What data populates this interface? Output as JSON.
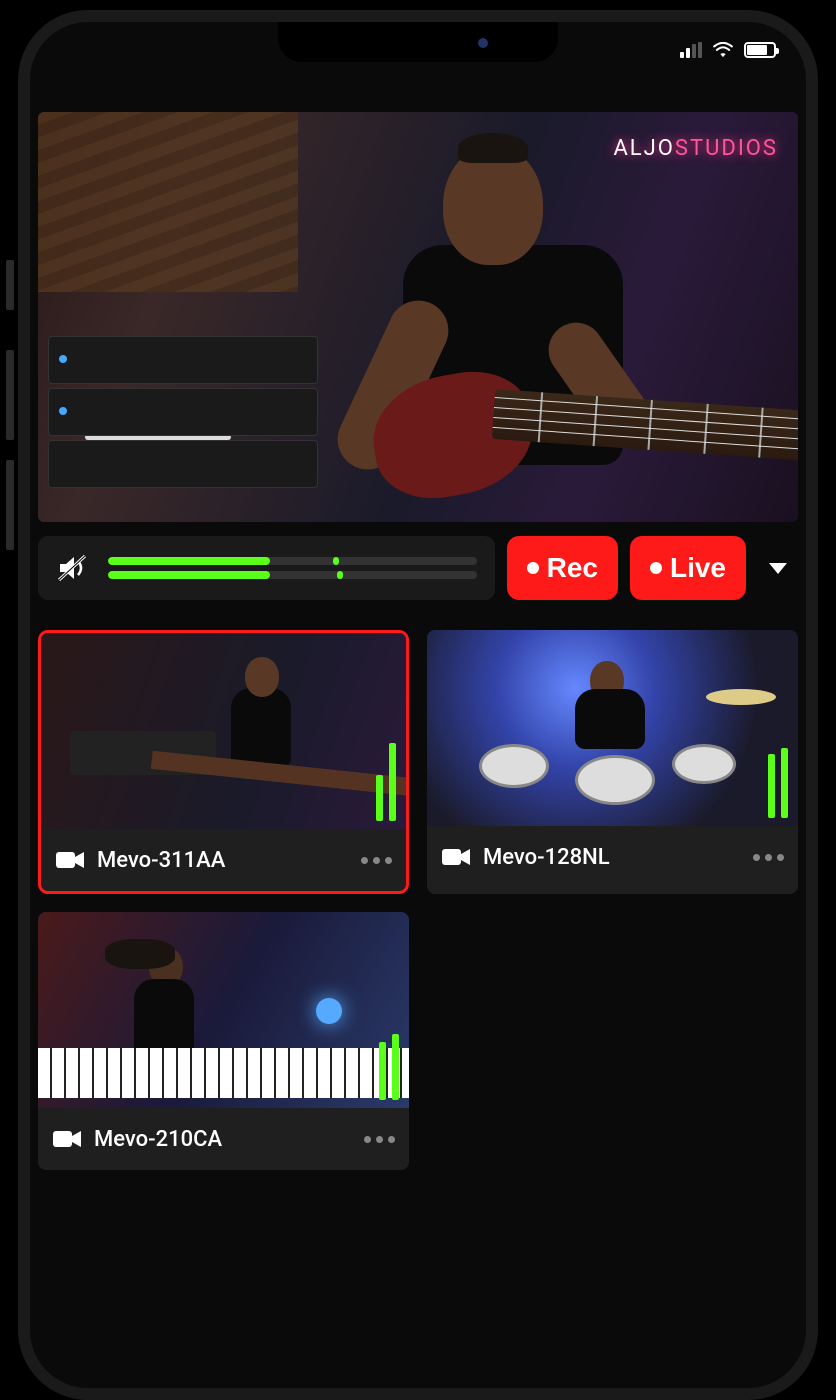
{
  "studio_sign": {
    "part1": "ALJO",
    "part2": "STUDIOS"
  },
  "controls": {
    "rec_label": "Rec",
    "live_label": "Live",
    "audio": {
      "muted": true,
      "level_top_pct": 44,
      "level_bot_pct": 44,
      "peak_top_pct": 61,
      "peak_bot_pct": 62
    }
  },
  "cameras": [
    {
      "name": "Mevo-311AA",
      "selected": true,
      "scene": "scene-bass",
      "level1": 46,
      "level2": 78
    },
    {
      "name": "Mevo-128NL",
      "selected": false,
      "scene": "scene-drums",
      "level1": 64,
      "level2": 70
    },
    {
      "name": "Mevo-210CA",
      "selected": false,
      "scene": "scene-keys",
      "level1": 58,
      "level2": 66
    }
  ]
}
